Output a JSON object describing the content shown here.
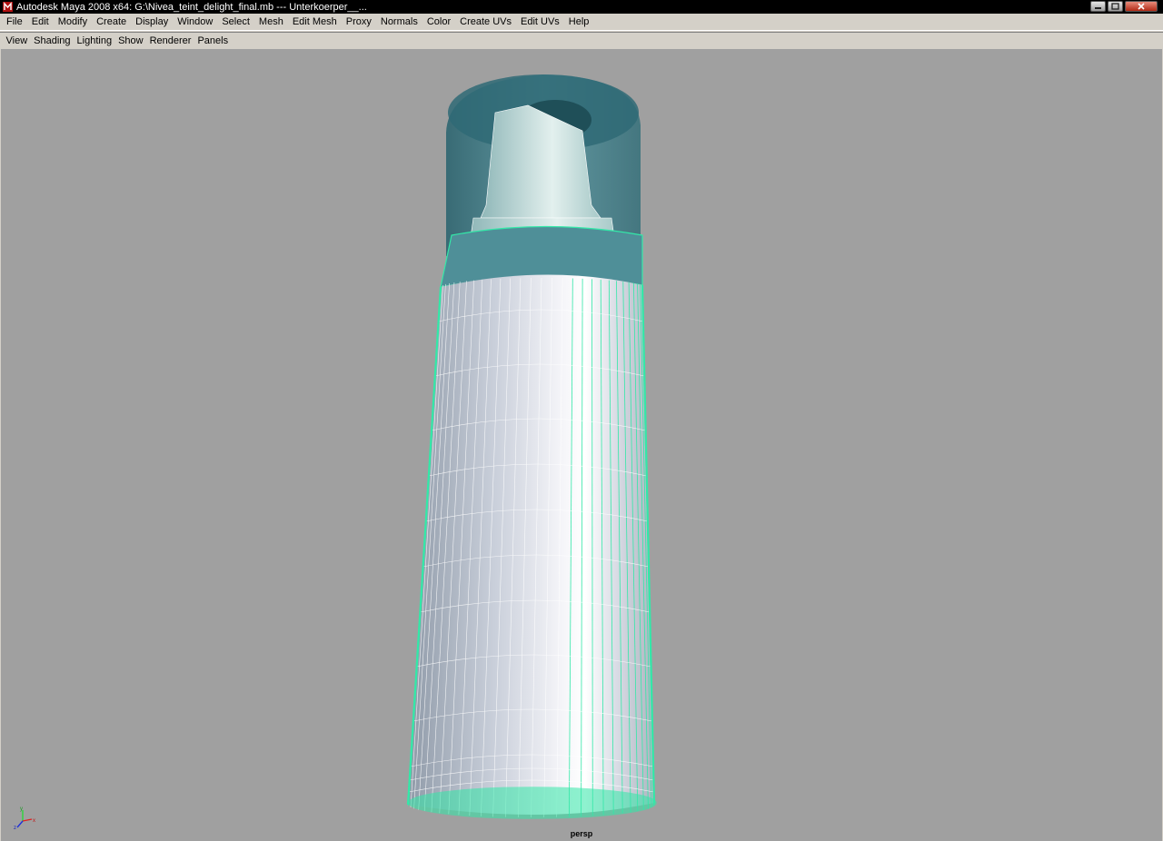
{
  "window": {
    "title": "Autodesk Maya 2008 x64: G:\\Nivea_teint_delight_final.mb   ---   Unterkoerper__..."
  },
  "menubar": {
    "items": [
      {
        "id": "file",
        "label": "File"
      },
      {
        "id": "edit",
        "label": "Edit"
      },
      {
        "id": "modify",
        "label": "Modify"
      },
      {
        "id": "create",
        "label": "Create"
      },
      {
        "id": "display",
        "label": "Display"
      },
      {
        "id": "window",
        "label": "Window"
      },
      {
        "id": "select",
        "label": "Select"
      },
      {
        "id": "mesh",
        "label": "Mesh"
      },
      {
        "id": "edit-mesh",
        "label": "Edit Mesh"
      },
      {
        "id": "proxy",
        "label": "Proxy"
      },
      {
        "id": "normals",
        "label": "Normals"
      },
      {
        "id": "color",
        "label": "Color"
      },
      {
        "id": "create-uvs",
        "label": "Create UVs"
      },
      {
        "id": "edit-uvs",
        "label": "Edit UVs"
      },
      {
        "id": "help",
        "label": "Help"
      }
    ]
  },
  "panel_menu": {
    "items": [
      {
        "id": "view",
        "label": "View"
      },
      {
        "id": "shading",
        "label": "Shading"
      },
      {
        "id": "lighting",
        "label": "Lighting"
      },
      {
        "id": "show",
        "label": "Show"
      },
      {
        "id": "renderer",
        "label": "Renderer"
      },
      {
        "id": "panels",
        "label": "Panels"
      }
    ]
  },
  "viewport": {
    "camera": "persp",
    "background_color": "#a0a0a0",
    "wireframe_color": "#33e8a8",
    "cap_color": "#3f7f8a"
  },
  "axis": {
    "x": "x",
    "y": "y",
    "z": "z"
  },
  "icons": {
    "app": "maya-app-icon",
    "minimize": "minimize-icon",
    "maximize": "maximize-icon",
    "close": "close-icon"
  }
}
